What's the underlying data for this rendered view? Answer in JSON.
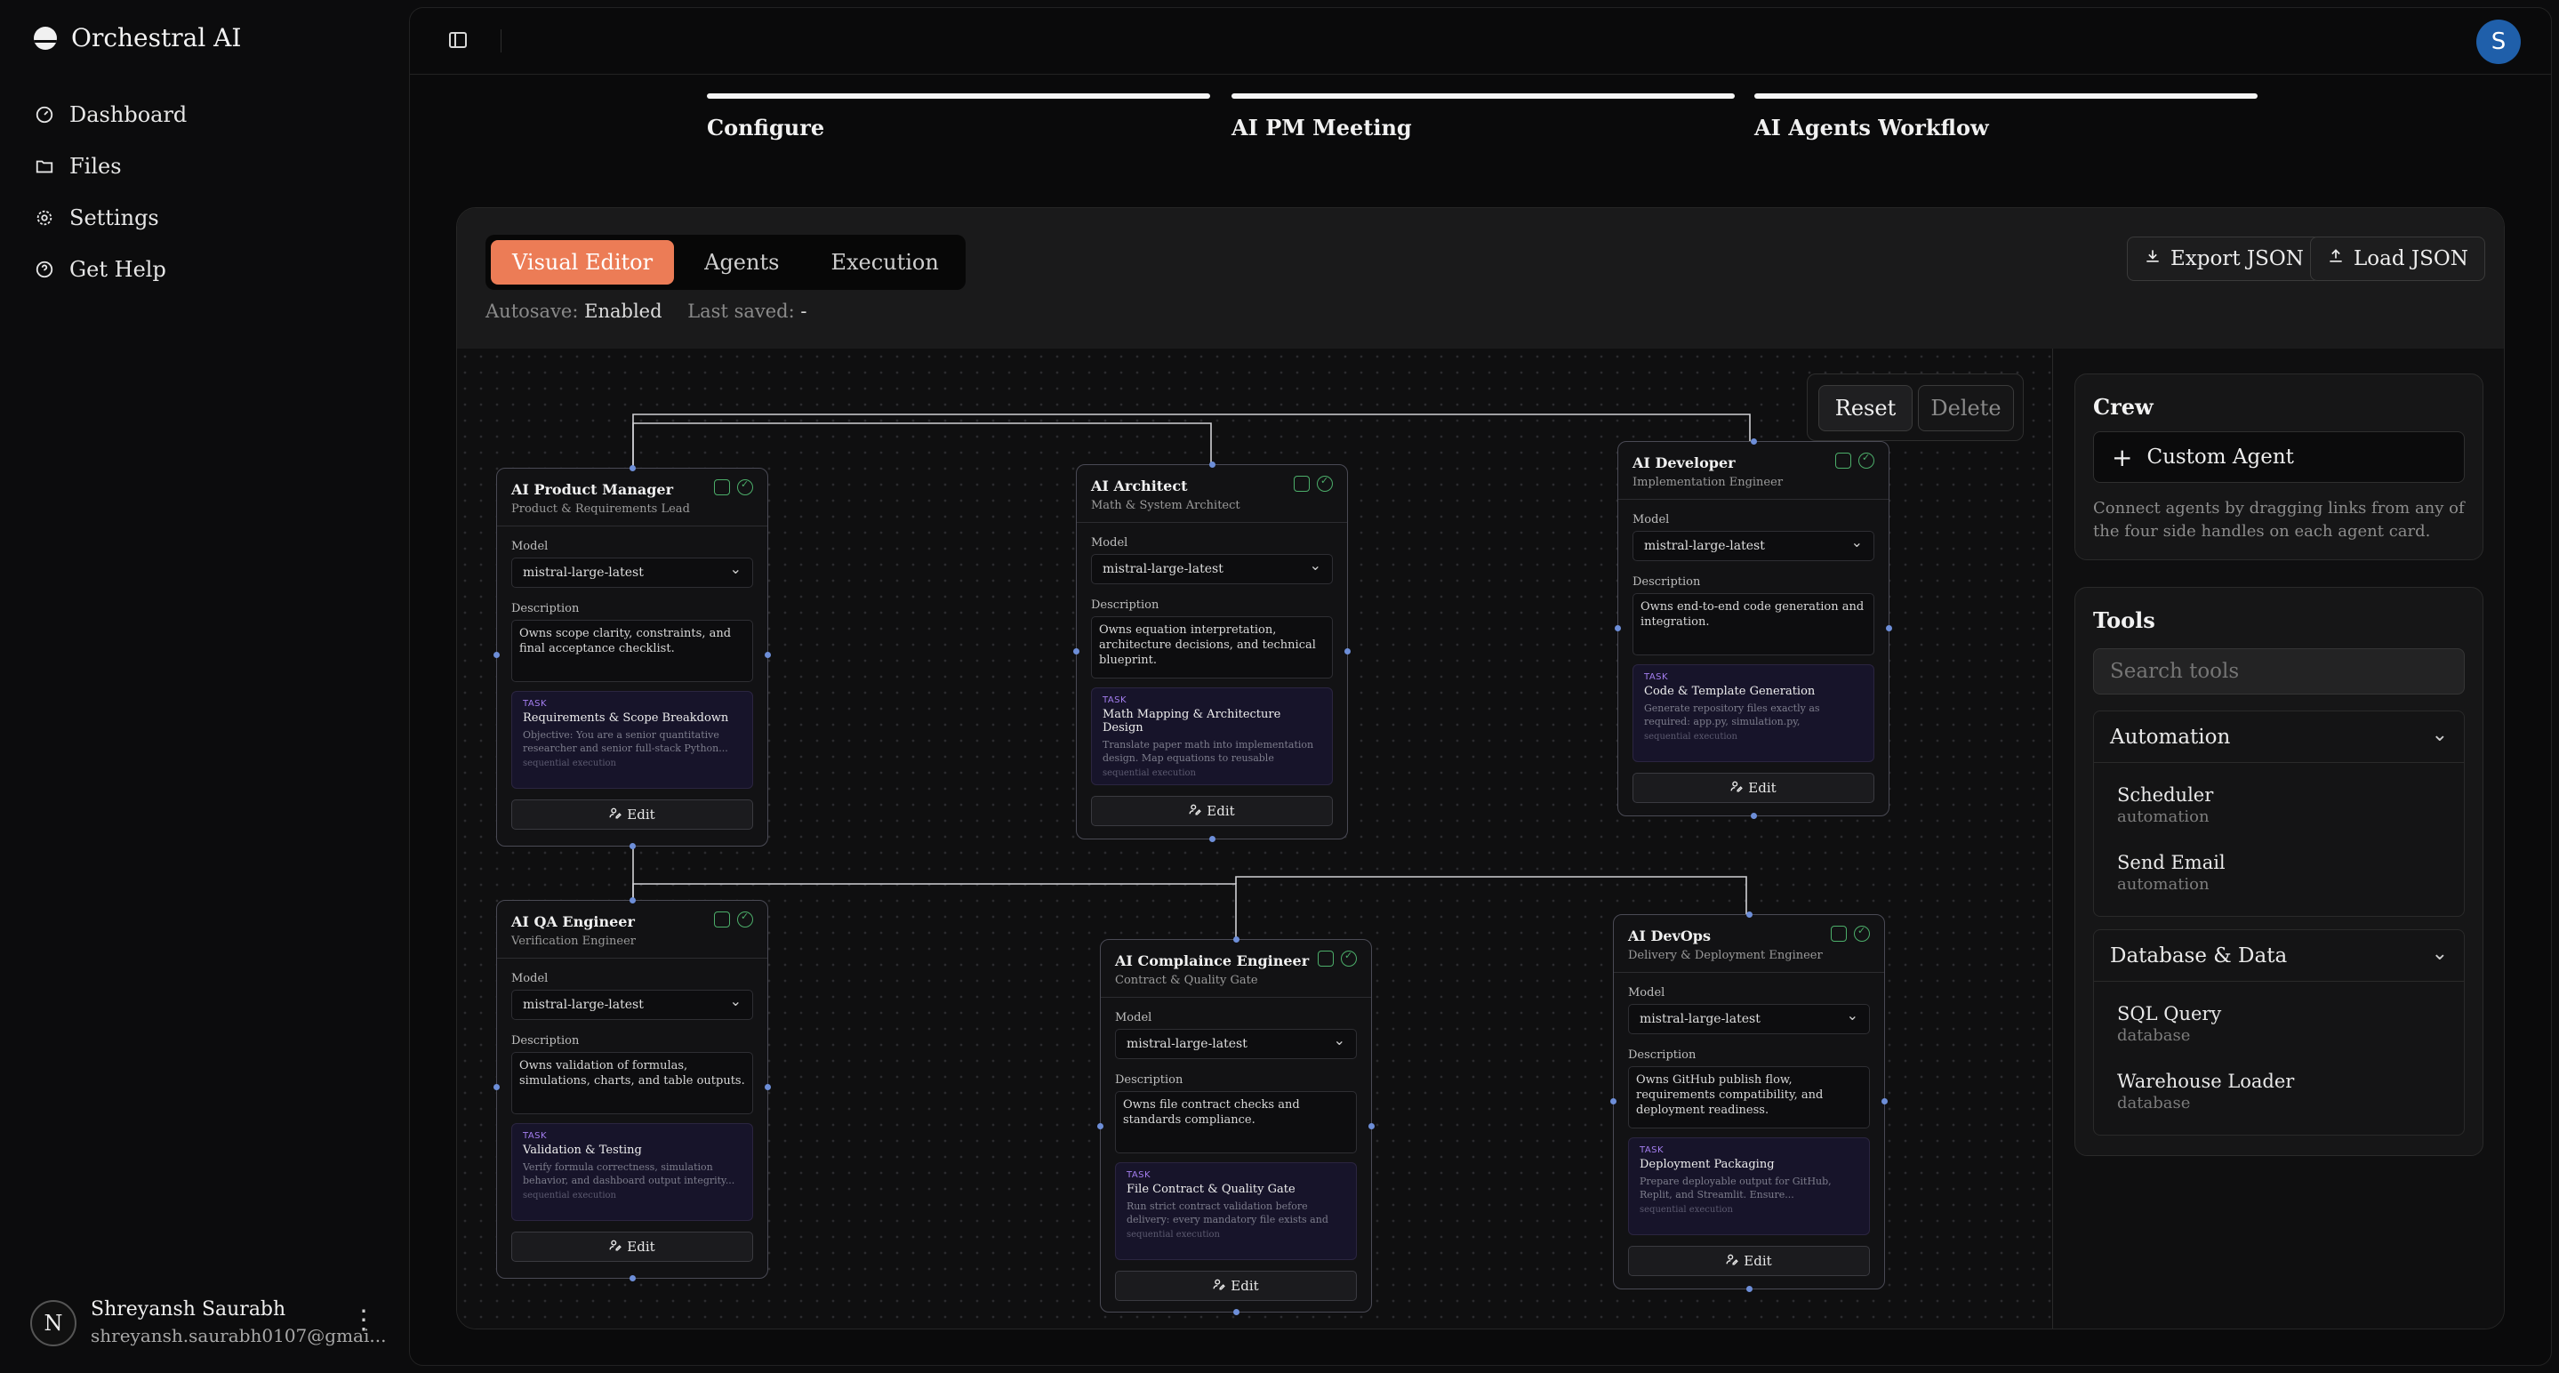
{
  "app": {
    "name": "Orchestral AI"
  },
  "nav": [
    {
      "label": "Dashboard",
      "icon": "dashboard-icon"
    },
    {
      "label": "Files",
      "icon": "folder-icon"
    },
    {
      "label": "Settings",
      "icon": "gear-icon"
    },
    {
      "label": "Get Help",
      "icon": "help-icon"
    }
  ],
  "user": {
    "initial": "N",
    "name": "Shreyansh Saurabh",
    "email": "shreyansh.saurabh0107@gmai..."
  },
  "topbar": {
    "avatar_initial": "S",
    "avatar_color": "#1f5faa"
  },
  "steps": [
    {
      "label": "Configure"
    },
    {
      "label": "AI PM Meeting"
    },
    {
      "label": "AI Agents Workflow"
    }
  ],
  "editor": {
    "tabs": [
      {
        "label": "Visual Editor",
        "active": true
      },
      {
        "label": "Agents",
        "active": false
      },
      {
        "label": "Execution",
        "active": false
      }
    ],
    "autosave_label": "Autosave:",
    "autosave_value": "Enabled",
    "last_saved_label": "Last saved:",
    "last_saved_value": "-",
    "export_label": "Export JSON",
    "load_label": "Load JSON",
    "reset_label": "Reset",
    "delete_label": "Delete",
    "accent_color": "#ec7c56"
  },
  "agent_labels": {
    "model": "Model",
    "description": "Description",
    "task_tag": "TASK",
    "edit": "Edit"
  },
  "agents": [
    {
      "title": "AI Product Manager",
      "subtitle": "Product & Requirements Lead",
      "model": "mistral-large-latest",
      "description": "Owns scope clarity, constraints, and final acceptance checklist.",
      "task_title": "Requirements & Scope Breakdown",
      "task_objective": "Objective: You are a senior quantitative researcher and senior full-stack Python...",
      "task_mode": "sequential execution"
    },
    {
      "title": "AI Architect",
      "subtitle": "Math & System Architect",
      "model": "mistral-large-latest",
      "description": "Owns equation interpretation, architecture decisions, and technical blueprint.",
      "task_title": "Math Mapping & Architecture Design",
      "task_objective": "Translate paper math into implementation design. Map equations to reusable function...",
      "task_mode": "sequential execution"
    },
    {
      "title": "AI Developer",
      "subtitle": "Implementation Engineer",
      "model": "mistral-large-latest",
      "description": "Owns end-to-end code generation and integration.",
      "task_title": "Code & Template Generation",
      "task_objective": "Generate repository files exactly as required: app.py, simulation.py, formulas.py,...",
      "task_mode": "sequential execution"
    },
    {
      "title": "AI QA Engineer",
      "subtitle": "Verification Engineer",
      "model": "mistral-large-latest",
      "description": "Owns validation of formulas, simulations, charts, and table outputs.",
      "task_title": "Validation & Testing",
      "task_objective": "Verify formula correctness, simulation behavior, and dashboard output integrity...",
      "task_mode": "sequential execution"
    },
    {
      "title": "AI Complaince Engineer",
      "subtitle": "Contract & Quality Gate",
      "model": "mistral-large-latest",
      "description": "Owns file contract checks and standards compliance.",
      "task_title": "File Contract & Quality Gate",
      "task_objective": "Run strict contract validation before delivery: every mandatory file exists and is...",
      "task_mode": "sequential execution"
    },
    {
      "title": "AI DevOps",
      "subtitle": "Delivery & Deployment Engineer",
      "model": "mistral-large-latest",
      "description": "Owns GitHub publish flow, requirements compatibility, and deployment readiness.",
      "task_title": "Deployment Packaging",
      "task_objective": "Prepare deployable output for GitHub, Replit, and Streamlit. Ensure...",
      "task_mode": "sequential execution"
    }
  ],
  "crew": {
    "title": "Crew",
    "custom_agent_label": "Custom Agent",
    "help": "Connect agents by dragging links from any of the four side handles on each agent card."
  },
  "tools": {
    "title": "Tools",
    "search_placeholder": "Search tools",
    "groups": [
      {
        "name": "Automation",
        "items": [
          {
            "name": "Scheduler",
            "category": "automation"
          },
          {
            "name": "Send Email",
            "category": "automation"
          }
        ]
      },
      {
        "name": "Database & Data",
        "items": [
          {
            "name": "SQL Query",
            "category": "database"
          },
          {
            "name": "Warehouse Loader",
            "category": "database"
          }
        ]
      }
    ]
  }
}
